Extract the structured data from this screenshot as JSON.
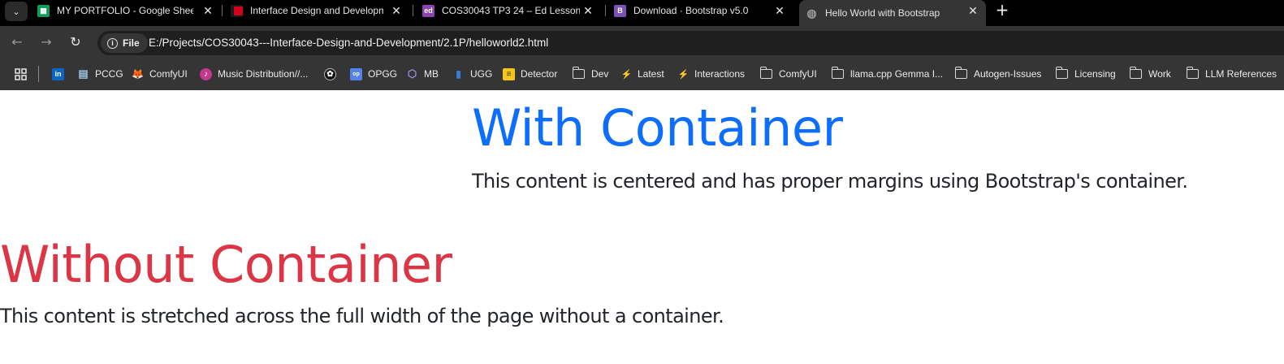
{
  "browser": {
    "tabs": [
      {
        "title": "MY PORTFOLIO - Google Sheet",
        "favicon": "google-sheets-icon",
        "favicon_color": "#0f9d58",
        "favicon_glyph": "▦"
      },
      {
        "title": "Interface Design and Developm",
        "favicon": "swinburne-icon",
        "favicon_color": "#d6001c",
        "favicon_glyph": ""
      },
      {
        "title": "COS30043 TP3 24 – Ed Lessons",
        "favicon": "ed-icon",
        "favicon_color": "#8e44ad",
        "favicon_glyph": "ed"
      },
      {
        "title": "Download · Bootstrap v5.0",
        "favicon": "bootstrap-icon",
        "favicon_color": "#7952b3",
        "favicon_glyph": "B"
      },
      {
        "title": "Hello World with Bootstrap",
        "favicon": "globe-icon",
        "favicon_color": "#8a8a8a",
        "favicon_glyph": "◍",
        "active": true
      }
    ],
    "tab_close_glyph": "✕",
    "tab_menu_glyph": "⌄",
    "new_tab_glyph": "+",
    "nav": {
      "back_glyph": "←",
      "forward_glyph": "→",
      "reload_glyph": "↻"
    },
    "address": {
      "chip_label": "File",
      "chip_info_glyph": "i",
      "url": "E:/Projects/COS30043---Interface-Design-and-Development/2.1P/helloworld2.html"
    },
    "bookmarks": [
      {
        "label": "",
        "icon": "apps-grid-icon",
        "glyph": "▦",
        "color": "#ffffff",
        "bg": "transparent"
      },
      {
        "label": "",
        "icon": "linkedin-icon",
        "glyph": "in",
        "color": "#ffffff",
        "bg": "#0a66c2"
      },
      {
        "label": "PCCG",
        "icon": "pccg-icon",
        "glyph": "▤",
        "color": "#9cc3e6",
        "bg": "transparent"
      },
      {
        "label": "ComfyUI",
        "icon": "comfyui-fox-icon",
        "glyph": "🦊",
        "color": "#f0a030",
        "bg": "transparent"
      },
      {
        "label": "Music Distribution//...",
        "icon": "music-icon",
        "glyph": "♪",
        "color": "#ffffff",
        "bg": "#c2398e"
      },
      {
        "label": "",
        "icon": "openai-icon",
        "glyph": "✿",
        "color": "#ffffff",
        "bg": "#111111"
      },
      {
        "label": "OPGG",
        "icon": "opgg-icon",
        "glyph": "op",
        "color": "#ffffff",
        "bg": "#5383e8"
      },
      {
        "label": "MB",
        "icon": "mb-icon",
        "glyph": "⬡",
        "color": "#9c8fe0",
        "bg": "transparent"
      },
      {
        "label": "UGG",
        "icon": "ugg-icon",
        "glyph": "▮",
        "color": "#3a7bd5",
        "bg": "transparent"
      },
      {
        "label": "Detector",
        "icon": "detector-icon",
        "glyph": "≡",
        "color": "#333333",
        "bg": "#f5c518"
      },
      {
        "label": "Dev",
        "icon": "folder-icon",
        "glyph": "",
        "color": "#d8d8d8",
        "bg": "transparent"
      },
      {
        "label": "Latest",
        "icon": "flame-icon",
        "glyph": "⚡",
        "color": "#ffffff",
        "bg": "transparent"
      },
      {
        "label": "Interactions",
        "icon": "flame-icon",
        "glyph": "⚡",
        "color": "#ffffff",
        "bg": "transparent"
      },
      {
        "label": "ComfyUI",
        "icon": "folder-icon",
        "glyph": "",
        "color": "#d8d8d8",
        "bg": "transparent"
      },
      {
        "label": "llama.cpp Gemma I...",
        "icon": "folder-icon",
        "glyph": "",
        "color": "#d8d8d8",
        "bg": "transparent"
      },
      {
        "label": "Autogen-Issues",
        "icon": "folder-icon",
        "glyph": "",
        "color": "#d8d8d8",
        "bg": "transparent"
      },
      {
        "label": "Licensing",
        "icon": "folder-icon",
        "glyph": "",
        "color": "#d8d8d8",
        "bg": "transparent"
      },
      {
        "label": "Work",
        "icon": "folder-icon",
        "glyph": "",
        "color": "#d8d8d8",
        "bg": "transparent"
      },
      {
        "label": "LLM References",
        "icon": "folder-icon",
        "glyph": "",
        "color": "#d8d8d8",
        "bg": "transparent"
      }
    ]
  },
  "page": {
    "with_container": {
      "heading": "With Container",
      "text": "This content is centered and has proper margins using Bootstrap's container.",
      "heading_color": "#0d6efd"
    },
    "without_container": {
      "heading": "Without Container",
      "text": "This content is stretched across the full width of the page without a container.",
      "heading_color": "#dc3545"
    }
  }
}
